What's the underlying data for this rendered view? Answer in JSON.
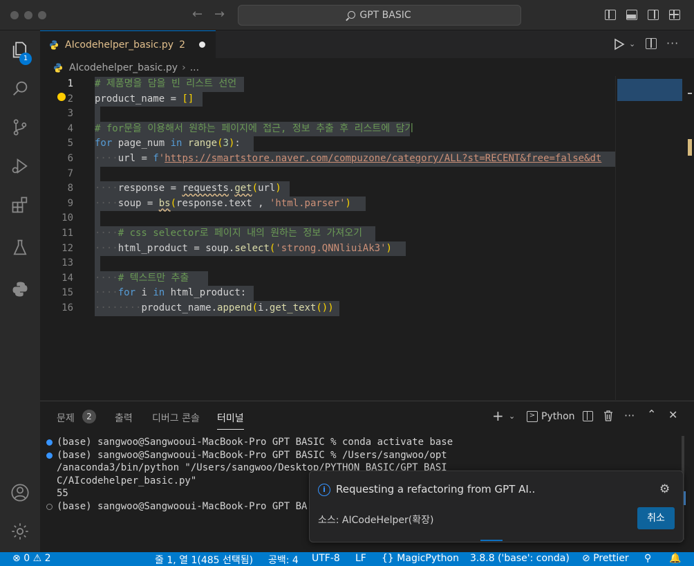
{
  "window": {
    "search_text": "GPT BASIC"
  },
  "activity": {
    "explorer_badge": "1"
  },
  "tab": {
    "file_name": "AIcodehelper_basic.py",
    "problem_count": "2"
  },
  "breadcrumb": {
    "file": "AIcodehelper_basic.py",
    "more": "..."
  },
  "editor": {
    "lines": [
      {
        "n": "1",
        "c": "# 제품명을 담을 빈 리스트 선언"
      },
      {
        "n": "2",
        "c": "product_name = []"
      },
      {
        "n": "3",
        "c": ""
      },
      {
        "n": "4",
        "c": "# for문을 이용해서 원하는 페이지에 접근, 정보 추출 후 리스트에 담기"
      },
      {
        "n": "5",
        "c": "for page_num in range(3):"
      },
      {
        "n": "6",
        "c": "    url = f'https://smartstore.naver.com/compuzone/category/ALL?st=RECENT&free=false&dt"
      },
      {
        "n": "7",
        "c": ""
      },
      {
        "n": "8",
        "c": "    response = requests.get(url)"
      },
      {
        "n": "9",
        "c": "    soup = bs(response.text , 'html.parser')"
      },
      {
        "n": "10",
        "c": ""
      },
      {
        "n": "11",
        "c": "    # css selector로 페이지 내의 원하는 정보 가져오기"
      },
      {
        "n": "12",
        "c": "    html_product = soup.select('strong.QNNliuiAk3')"
      },
      {
        "n": "13",
        "c": ""
      },
      {
        "n": "14",
        "c": "    # 텍스트만 추출"
      },
      {
        "n": "15",
        "c": "    for i in html_product:"
      },
      {
        "n": "16",
        "c": "        product_name.append(i.get_text())"
      }
    ]
  },
  "panel": {
    "tabs": [
      "문제",
      "출력",
      "디버그 콘솔",
      "터미널"
    ],
    "problems_count": "2",
    "terminal_profile": "Python",
    "terminal": [
      "(base) sangwoo@Sangwooui-MacBook-Pro GPT BASIC % conda activate base",
      "(base) sangwoo@Sangwooui-MacBook-Pro GPT BASIC % /Users/sangwoo/opt",
      "/anaconda3/bin/python \"/Users/sangwoo/Desktop/PYTHON_BASIC/GPT_BASI",
      "C/AIcodehelper_basic.py\"",
      "55",
      "(base) sangwoo@Sangwooui-MacBook-Pro GPT BA"
    ]
  },
  "notification": {
    "message": "Requesting a refactoring from GPT AI..",
    "source": "소스: AICodeHelper(확장)",
    "cancel_label": "취소"
  },
  "status": {
    "errors": "0",
    "warnings": "2",
    "cursor": "줄 1, 열 1(485 선택됨)",
    "spaces": "공백: 4",
    "encoding": "UTF-8",
    "eol": "LF",
    "language": "MagicPython",
    "interpreter": "3.8.8 ('base': conda)",
    "formatter": "Prettier"
  },
  "colors": {
    "accent": "#007acc",
    "warning": "#e2c08d",
    "keyword": "#569cd6",
    "string": "#ce9178",
    "comment": "#6a9955"
  },
  "icons": [
    "explorer-icon",
    "search-icon",
    "source-control-icon",
    "run-debug-icon",
    "extensions-icon",
    "testing-icon",
    "python-icon",
    "account-icon",
    "settings-gear-icon"
  ]
}
